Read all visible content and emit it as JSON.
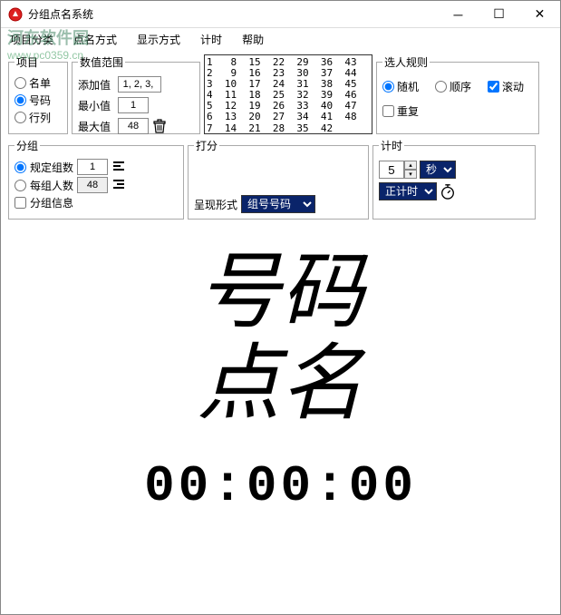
{
  "window": {
    "title": "分组点名系统"
  },
  "menu": {
    "m1": "项目分类",
    "m2": "点名方式",
    "m3": "显示方式",
    "m4": "计时",
    "m5": "帮助"
  },
  "watermark": {
    "name": "河东软件园",
    "url": "www.pc0359.cn"
  },
  "project": {
    "legend": "项目",
    "opt1": "名单",
    "opt2": "号码",
    "opt3": "行列"
  },
  "range": {
    "legend": "数值范围",
    "add_label": "添加值",
    "add_value": "1, 2, 3, ",
    "min_label": "最小值",
    "min_value": "1",
    "max_label": "最大值",
    "max_value": "48"
  },
  "numbers": "1   8  15  22  29  36  43\n2   9  16  23  30  37  44\n3  10  17  24  31  38  45\n4  11  18  25  32  39  46\n5  12  19  26  33  40  47\n6  13  20  27  34  41  48\n7  14  21  28  35  42",
  "rules": {
    "legend": "选人规则",
    "r1": "随机",
    "r2": "顺序",
    "r3": "滚动",
    "r4": "重复"
  },
  "group": {
    "legend": "分组",
    "g1": "规定组数",
    "g1v": "1",
    "g2": "每组人数",
    "g2v": "48",
    "g3": "分组信息"
  },
  "score": {
    "legend": "打分",
    "form_label": "呈现形式",
    "form_value": "组号号码"
  },
  "timer": {
    "legend": "计时",
    "value": "5",
    "unit": "秒",
    "mode": "正计时"
  },
  "display": {
    "line1": "号码",
    "line2": "点名",
    "time": "00:00:00"
  }
}
